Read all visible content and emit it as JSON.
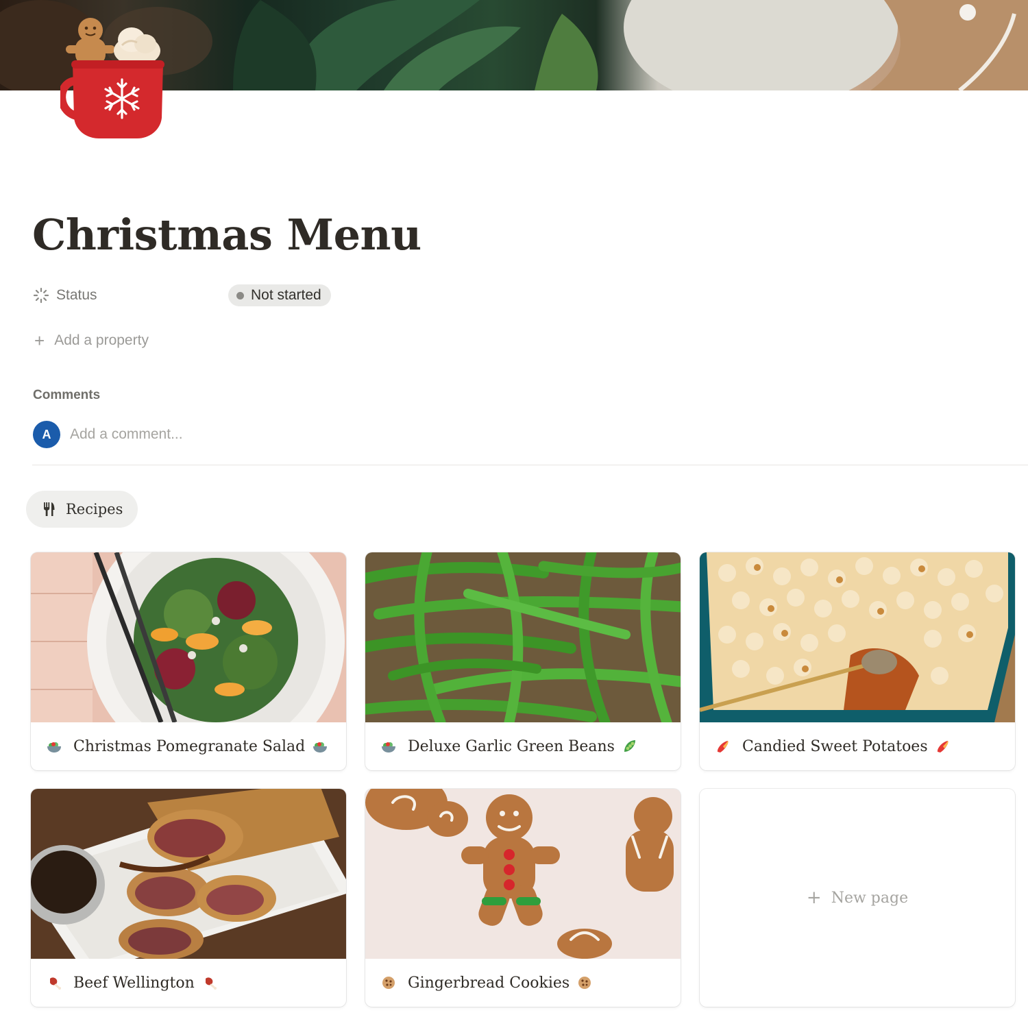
{
  "page": {
    "title": "Christmas Menu",
    "cover_icon": "hot-cocoa-mug-icon"
  },
  "properties": {
    "status": {
      "icon": "status-loading-icon",
      "label": "Status",
      "value": "Not started"
    },
    "add_property_label": "Add a property"
  },
  "comments": {
    "label": "Comments",
    "avatar_initial": "A",
    "placeholder": "Add a comment..."
  },
  "view": {
    "icon": "fork-knife-icon",
    "label": "Recipes"
  },
  "cards": [
    {
      "title": "Christmas Pomegranate Salad",
      "lead_icon": "salad-bowl-icon",
      "trail_icon": "salad-bowl-icon"
    },
    {
      "title": "Deluxe Garlic Green Beans",
      "lead_icon": "salad-bowl-icon",
      "trail_icon": "pea-pod-icon"
    },
    {
      "title": "Candied Sweet Potatoes",
      "lead_icon": "sweet-potato-icon",
      "trail_icon": "sweet-potato-icon"
    },
    {
      "title": "Beef Wellington",
      "lead_icon": "meat-on-bone-icon",
      "trail_icon": "meat-on-bone-icon"
    },
    {
      "title": "Gingerbread Cookies",
      "lead_icon": "cookie-icon",
      "trail_icon": "cookie-icon"
    }
  ],
  "new_page_label": "New page",
  "colors": {
    "status_pill": "#e9e9e7",
    "avatar": "#1b5cab",
    "mug_red": "#d4292d"
  }
}
